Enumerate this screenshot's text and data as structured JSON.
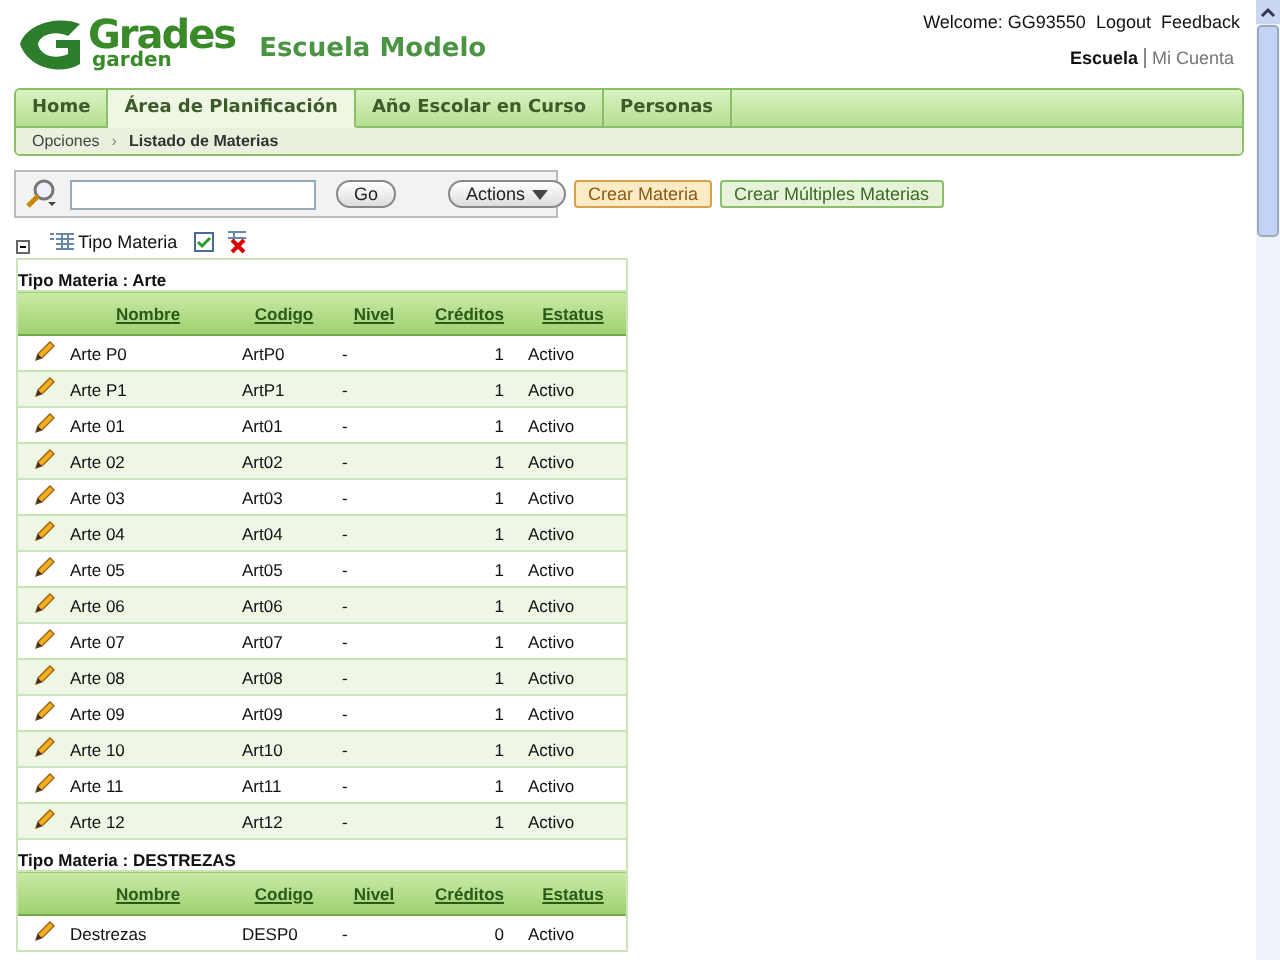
{
  "logo": {
    "title": "Grades",
    "subtitle": "garden"
  },
  "school": "Escuela Modelo",
  "user_bar": {
    "welcome": "Welcome: GG93550",
    "logout": "Logout",
    "feedback": "Feedback"
  },
  "account_links": [
    {
      "label": "Escuela",
      "selected": true
    },
    {
      "label": "Mi Cuenta",
      "selected": false
    }
  ],
  "tabs": [
    {
      "label": "Home",
      "selected": false
    },
    {
      "label": "Área de Planificación",
      "selected": true
    },
    {
      "label": "Año Escolar en Curso",
      "selected": false
    },
    {
      "label": "Personas",
      "selected": false
    }
  ],
  "breadcrumb": {
    "items": [
      "Opciones",
      "Listado de Materias"
    ],
    "separator": "›"
  },
  "search": {
    "button": "Go",
    "actions": "Actions"
  },
  "buttons": [
    {
      "label": "Crear Materia",
      "kind": "primary"
    },
    {
      "label": "Crear Múltiples Materias",
      "kind": "secondary"
    }
  ],
  "grouping": {
    "expanded": true,
    "label": "Tipo Materia"
  },
  "groups": [
    {
      "title": "Tipo Materia : Arte",
      "columns": [
        "Nombre",
        "Codigo",
        "Nivel",
        "Créditos",
        "Estatus"
      ],
      "rows": [
        [
          "Arte P0",
          "ArtP0",
          "-",
          "1",
          "Activo"
        ],
        [
          "Arte P1",
          "ArtP1",
          "-",
          "1",
          "Activo"
        ],
        [
          "Arte 01",
          "Art01",
          "-",
          "1",
          "Activo"
        ],
        [
          "Arte 02",
          "Art02",
          "-",
          "1",
          "Activo"
        ],
        [
          "Arte 03",
          "Art03",
          "-",
          "1",
          "Activo"
        ],
        [
          "Arte 04",
          "Art04",
          "-",
          "1",
          "Activo"
        ],
        [
          "Arte 05",
          "Art05",
          "-",
          "1",
          "Activo"
        ],
        [
          "Arte 06",
          "Art06",
          "-",
          "1",
          "Activo"
        ],
        [
          "Arte 07",
          "Art07",
          "-",
          "1",
          "Activo"
        ],
        [
          "Arte 08",
          "Art08",
          "-",
          "1",
          "Activo"
        ],
        [
          "Arte 09",
          "Art09",
          "-",
          "1",
          "Activo"
        ],
        [
          "Arte 10",
          "Art10",
          "-",
          "1",
          "Activo"
        ],
        [
          "Arte 11",
          "Art11",
          "-",
          "1",
          "Activo"
        ],
        [
          "Arte 12",
          "Art12",
          "-",
          "1",
          "Activo"
        ]
      ]
    },
    {
      "title": "Tipo Materia : DESTREZAS",
      "columns": [
        "Nombre",
        "Codigo",
        "Nivel",
        "Créditos",
        "Estatus"
      ],
      "rows": [
        [
          "Destrezas",
          "DESP0",
          "-",
          "0",
          "Activo"
        ]
      ]
    }
  ]
}
